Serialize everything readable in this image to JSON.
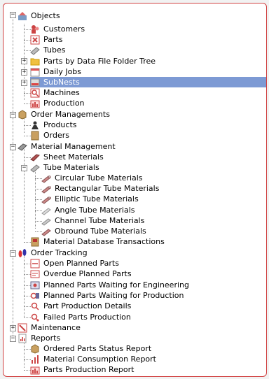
{
  "tree": {
    "objects": {
      "label": "Objects",
      "children": {
        "customers": "Customers",
        "parts": "Parts",
        "tubes": "Tubes",
        "parts_by_folder": "Parts by Data File Folder Tree",
        "daily_jobs": "Daily Jobs",
        "subnests": "SubNests",
        "machines": "Machines",
        "production": "Production"
      }
    },
    "order_managements": {
      "label": "Order Managements",
      "children": {
        "products": "Products",
        "orders": "Orders"
      }
    },
    "material_management": {
      "label": "Material Management",
      "children": {
        "sheet_materials": "Sheet Materials",
        "tube_materials": "Tube Materials",
        "circular": "Circular Tube Materials",
        "rectangular": "Rectangular Tube Materials",
        "elliptic": "Elliptic Tube Materials",
        "angle": "Angle Tube Materials",
        "channel": "Channel Tube Materials",
        "obround": "Obround Tube Materials",
        "db_transactions": "Material Database Transactions"
      }
    },
    "order_tracking": {
      "label": "Order Tracking",
      "children": {
        "open_planned": "Open Planned Parts",
        "overdue_planned": "Overdue Planned Parts",
        "waiting_engineering": "Planned Parts Waiting for Engineering",
        "waiting_production": "Planned Parts Waiting for Production",
        "part_production_details": "Part Production Details",
        "failed_parts": "Failed Parts Production"
      }
    },
    "maintenance": {
      "label": "Maintenance"
    },
    "reports": {
      "label": "Reports",
      "children": {
        "ordered_status": "Ordered Parts Status Report",
        "material_consumption": "Material Consumption Report",
        "parts_production": "Parts Production Report"
      }
    },
    "selected_item": "SubNests"
  },
  "colors": {
    "selection": "#7d9ad4",
    "panel_border": "#d04040"
  }
}
